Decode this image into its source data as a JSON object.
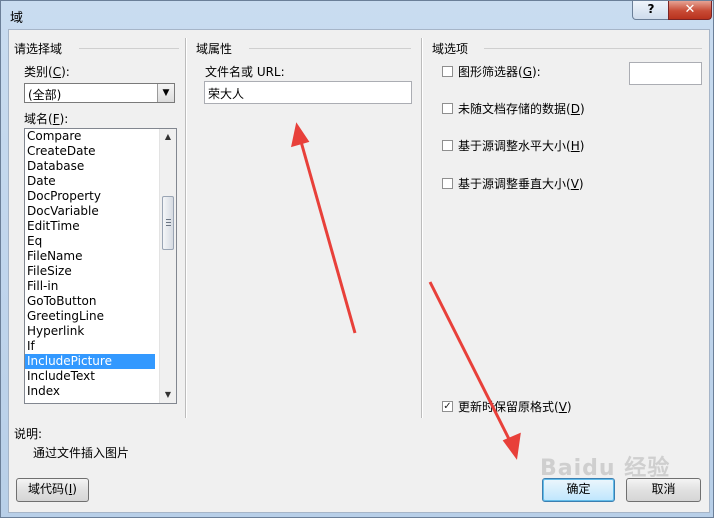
{
  "window": {
    "title": "域"
  },
  "titlebar": {
    "help_glyph": "?",
    "close_glyph": "✕"
  },
  "left": {
    "group_title": "请选择域",
    "category_label": "类别(",
    "category_key": "C",
    "category_label_end": "):",
    "category_value": "(全部)",
    "fieldnames_label": "域名(",
    "fieldnames_key": "F",
    "fieldnames_label_end": "):",
    "field_names": [
      "Compare",
      "CreateDate",
      "Database",
      "Date",
      "DocProperty",
      "DocVariable",
      "EditTime",
      "Eq",
      "FileName",
      "FileSize",
      "Fill-in",
      "GoToButton",
      "GreetingLine",
      "Hyperlink",
      "If",
      "IncludePicture",
      "IncludeText",
      "Index"
    ],
    "selected_field": "IncludePicture"
  },
  "middle": {
    "group_title": "域属性",
    "url_label": "文件名或 URL:",
    "url_value": "荣大人"
  },
  "right": {
    "group_title": "域选项",
    "options": [
      {
        "label": "图形筛选器(",
        "key": "G",
        "end": "):",
        "checked": false
      },
      {
        "label": "未随文档存储的数据(",
        "key": "D",
        "end": ")",
        "checked": false
      },
      {
        "label": "基于源调整水平大小(",
        "key": "H",
        "end": ")",
        "checked": false
      },
      {
        "label": "基于源调整垂直大小(",
        "key": "V",
        "end": ")",
        "checked": false
      }
    ],
    "preserve_label": "更新时保留原格式(",
    "preserve_key": "V",
    "preserve_end": ")",
    "preserve_checked": true,
    "check_glyph": "✓"
  },
  "description": {
    "label": "说明:",
    "text": "通过文件插入图片"
  },
  "buttons": {
    "field_codes": "域代码(",
    "field_codes_key": "I",
    "field_codes_end": ")",
    "ok": "确定",
    "cancel": "取消"
  },
  "scroll": {
    "up_glyph": "▲",
    "down_glyph": "▼",
    "combo_glyph": "▼"
  },
  "watermark": {
    "text": "Baidu 经验"
  },
  "accent_colors": {
    "selection": "#3399ff",
    "annotation_arrow": "#e8403a"
  }
}
